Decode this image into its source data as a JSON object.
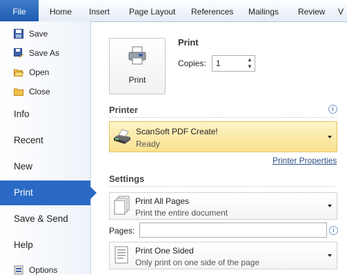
{
  "ribbon": {
    "tabs": [
      "File",
      "Home",
      "Insert",
      "Page Layout",
      "References",
      "Mailings",
      "Review",
      "V"
    ]
  },
  "nav": {
    "commands": [
      "Save",
      "Save As",
      "Open",
      "Close"
    ],
    "items": [
      "Info",
      "Recent",
      "New",
      "Print",
      "Save & Send",
      "Help"
    ],
    "options": "Options",
    "selected": "Print"
  },
  "print": {
    "button_label": "Print",
    "title": "Print",
    "copies_label": "Copies:",
    "copies_value": "1"
  },
  "printer": {
    "section": "Printer",
    "name": "ScanSoft PDF Create!",
    "status": "Ready",
    "properties_link": "Printer Properties"
  },
  "settings": {
    "section": "Settings",
    "range_title": "Print All Pages",
    "range_desc": "Print the entire document",
    "pages_label": "Pages:",
    "pages_value": "",
    "sides_title": "Print One Sided",
    "sides_desc": "Only print on one side of the page"
  },
  "colors": {
    "file_tab": "#2a6ac6",
    "nav_selected": "#2a6ac6",
    "printer_highlight": "#fbe28f"
  }
}
